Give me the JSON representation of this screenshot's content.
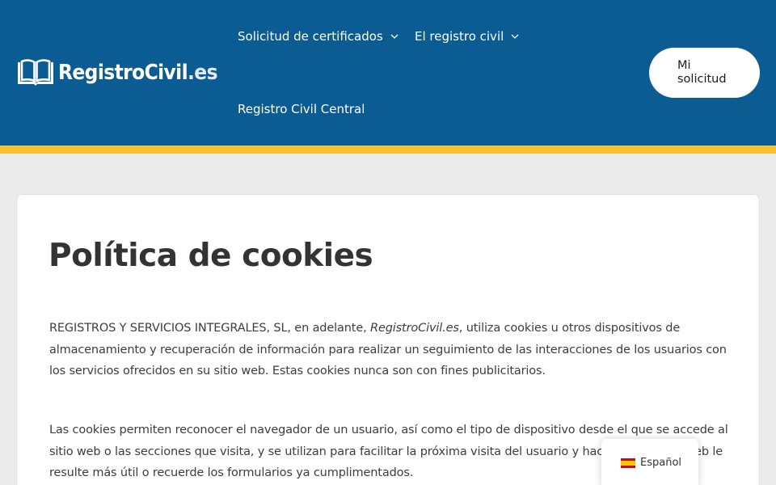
{
  "header": {
    "logo": {
      "main": "RegistroCivil",
      "suffix": ".es"
    },
    "nav": [
      {
        "label": "Solicitud de certificados",
        "has_dropdown": true
      },
      {
        "label": "El registro civil",
        "has_dropdown": true
      },
      {
        "label": "Registro Civil Central",
        "has_dropdown": false
      }
    ],
    "cta_label": "Mi solicitud"
  },
  "content": {
    "title": "Política de cookies",
    "para1": {
      "before": "REGISTROS Y SERVICIOS INTEGRALES, SL, en adelante, ",
      "em": "RegistroCivil.es",
      "after": ", utiliza cookies u otros dispositivos de almacenamiento y recuperación de información para realizar un seguimiento de las interacciones de los usuarios con los servicios ofrecidos en su sitio web. Estas cookies nunca son con fines publicitarios."
    },
    "para2": "Las cookies permiten reconocer el navegador de un usuario, así como el tipo de dispositivo desde el que se accede al sitio web o las secciones que visita, y se utilizan para facilitar la próxima visita del usuario y hacer que el sitio web le resulte más útil o recuerde los formularios ya cumplimentados."
  },
  "language_switcher": {
    "label": "Español",
    "flag": "spain-flag-icon"
  },
  "colors": {
    "header_bg": "#0c5c94",
    "accent_stripe": "#f6c02f",
    "page_bg": "#ebebeb"
  }
}
